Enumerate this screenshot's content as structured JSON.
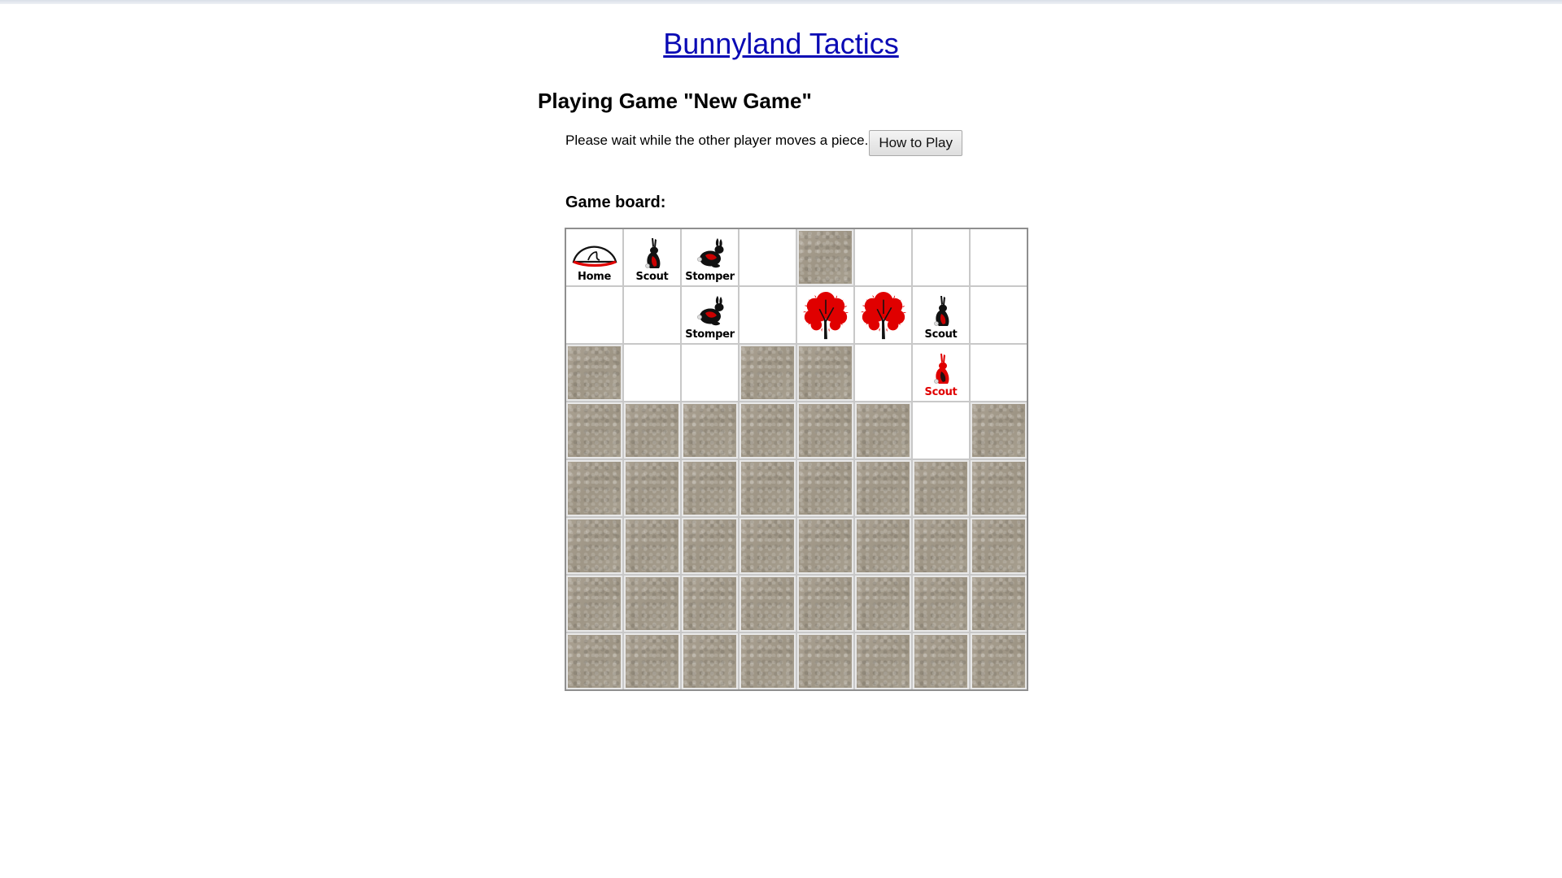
{
  "site": {
    "title": "Bunnyland Tactics"
  },
  "game": {
    "heading": "Playing Game \"New Game\"",
    "status": "Please wait while the other player moves a piece.",
    "how_to_play_label": "How to Play",
    "board_label": "Game board:"
  },
  "colors": {
    "link": "#0a0ab4",
    "fog": "#a49b8c",
    "opponent_red": "#e00000"
  },
  "board": {
    "rows": [
      [
        {
          "type": "piece",
          "piece": "home",
          "label": "Home",
          "owner": "player"
        },
        {
          "type": "piece",
          "piece": "scout",
          "label": "Scout",
          "owner": "player"
        },
        {
          "type": "piece",
          "piece": "stomper",
          "label": "Stomper",
          "owner": "player"
        },
        {
          "type": "empty"
        },
        {
          "type": "fog"
        },
        {
          "type": "empty"
        },
        {
          "type": "empty"
        },
        {
          "type": "empty"
        }
      ],
      [
        {
          "type": "empty"
        },
        {
          "type": "empty"
        },
        {
          "type": "piece",
          "piece": "stomper",
          "label": "Stomper",
          "owner": "player"
        },
        {
          "type": "empty"
        },
        {
          "type": "tree"
        },
        {
          "type": "tree"
        },
        {
          "type": "piece",
          "piece": "scout",
          "label": "Scout",
          "owner": "player"
        },
        {
          "type": "empty"
        }
      ],
      [
        {
          "type": "fog"
        },
        {
          "type": "empty"
        },
        {
          "type": "empty"
        },
        {
          "type": "fog"
        },
        {
          "type": "fog"
        },
        {
          "type": "empty"
        },
        {
          "type": "piece",
          "piece": "scout",
          "label": "Scout",
          "owner": "opponent"
        },
        {
          "type": "empty"
        }
      ],
      [
        {
          "type": "fog"
        },
        {
          "type": "fog"
        },
        {
          "type": "fog"
        },
        {
          "type": "fog"
        },
        {
          "type": "fog"
        },
        {
          "type": "fog"
        },
        {
          "type": "empty"
        },
        {
          "type": "fog"
        }
      ],
      [
        {
          "type": "fog"
        },
        {
          "type": "fog"
        },
        {
          "type": "fog"
        },
        {
          "type": "fog"
        },
        {
          "type": "fog"
        },
        {
          "type": "fog"
        },
        {
          "type": "fog"
        },
        {
          "type": "fog"
        }
      ],
      [
        {
          "type": "fog"
        },
        {
          "type": "fog"
        },
        {
          "type": "fog"
        },
        {
          "type": "fog"
        },
        {
          "type": "fog"
        },
        {
          "type": "fog"
        },
        {
          "type": "fog"
        },
        {
          "type": "fog"
        }
      ],
      [
        {
          "type": "fog"
        },
        {
          "type": "fog"
        },
        {
          "type": "fog"
        },
        {
          "type": "fog"
        },
        {
          "type": "fog"
        },
        {
          "type": "fog"
        },
        {
          "type": "fog"
        },
        {
          "type": "fog"
        }
      ],
      [
        {
          "type": "fog"
        },
        {
          "type": "fog"
        },
        {
          "type": "fog"
        },
        {
          "type": "fog"
        },
        {
          "type": "fog"
        },
        {
          "type": "fog"
        },
        {
          "type": "fog"
        },
        {
          "type": "fog"
        }
      ]
    ]
  }
}
